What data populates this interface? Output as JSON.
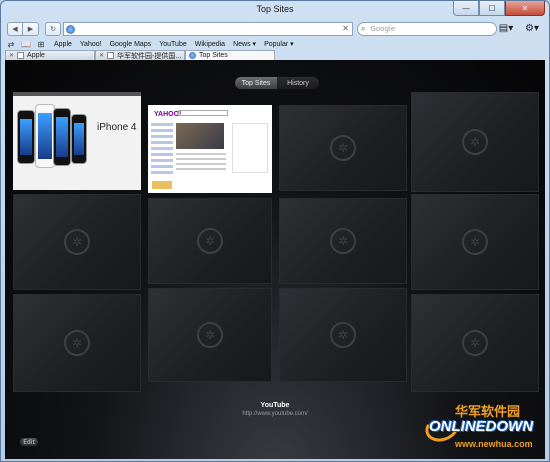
{
  "window": {
    "title": "Top Sites",
    "min_glyph": "—",
    "max_glyph": "☐",
    "close_glyph": "✕"
  },
  "toolbar": {
    "back_glyph": "◀",
    "forward_glyph": "▶",
    "reload_glyph": "↻",
    "url_value": "",
    "clear_glyph": "✕",
    "search_placeholder": "Google",
    "search_glyph": "⌕",
    "page_menu_glyph": "▤▾",
    "settings_glyph": "⚙▾"
  },
  "bookmarks_bar": {
    "icons": [
      "⇄",
      "📖",
      "⊞"
    ],
    "items": [
      "Apple",
      "Yahoo!",
      "Google Maps",
      "YouTube",
      "Wikipedia",
      "News ▾",
      "Popular ▾"
    ]
  },
  "tabs": [
    {
      "label": "Apple",
      "close": "✕"
    },
    {
      "label": "华军软件园-提供国...",
      "close": "✕"
    },
    {
      "label": "Top Sites",
      "close": ""
    }
  ],
  "top_sites": {
    "segments": {
      "top_sites": "Top Sites",
      "history": "History"
    },
    "apple_thumb_title": "iPhone 4",
    "yahoo_thumb_logo": "YAHOO!",
    "placeholder_glyph": "✲",
    "hover_title": "YouTube",
    "hover_url": "http://www.youtube.com/",
    "edit_label": "Edit"
  },
  "watermark": {
    "cn": "华军软件园",
    "en": "ONLINEDOWN",
    "url": "www.newhua.com"
  }
}
